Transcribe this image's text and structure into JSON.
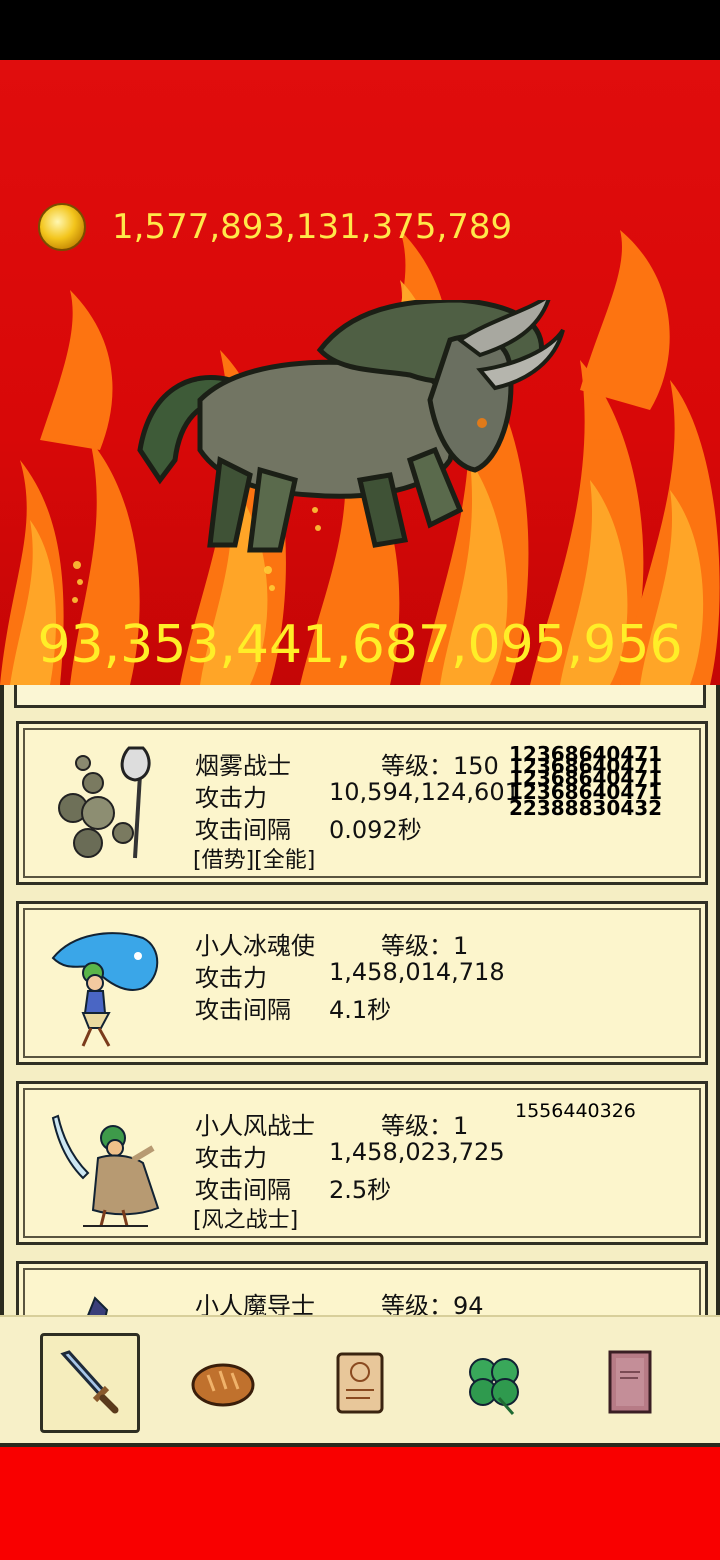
{
  "gold": "1,577,893,131,375,789",
  "damage": "93,353,441,687,095,956",
  "heroes": [
    {
      "name": "烟雾战士",
      "level_label": "等级：150",
      "attack_label": "攻击力",
      "attack_value": "10,594,124,601",
      "interval_label": "攻击间隔",
      "interval_value": "0.092秒",
      "traits": "[借势][全能]",
      "floating_numbers": [
        "12368640471",
        "22388830432"
      ]
    },
    {
      "name": "小人冰魂使",
      "level_label": "等级：1",
      "attack_label": "攻击力",
      "attack_value": "1,458,014,718",
      "interval_label": "攻击间隔",
      "interval_value": "4.1秒",
      "traits": ""
    },
    {
      "name": "小人风战士",
      "level_label": "等级：1",
      "attack_label": "攻击力",
      "attack_value": "1,458,023,725",
      "interval_label": "攻击间隔",
      "interval_value": "2.5秒",
      "traits": "[风之战士]",
      "floating_numbers": [
        "1556440326"
      ]
    },
    {
      "name": "小人魔导士",
      "level_label": "等级：94"
    }
  ],
  "nav": [
    {
      "icon": "sword-icon",
      "active": true
    },
    {
      "icon": "bread-icon",
      "active": false
    },
    {
      "icon": "scroll-icon",
      "active": false
    },
    {
      "icon": "clover-icon",
      "active": false
    },
    {
      "icon": "book-icon",
      "active": false
    }
  ]
}
